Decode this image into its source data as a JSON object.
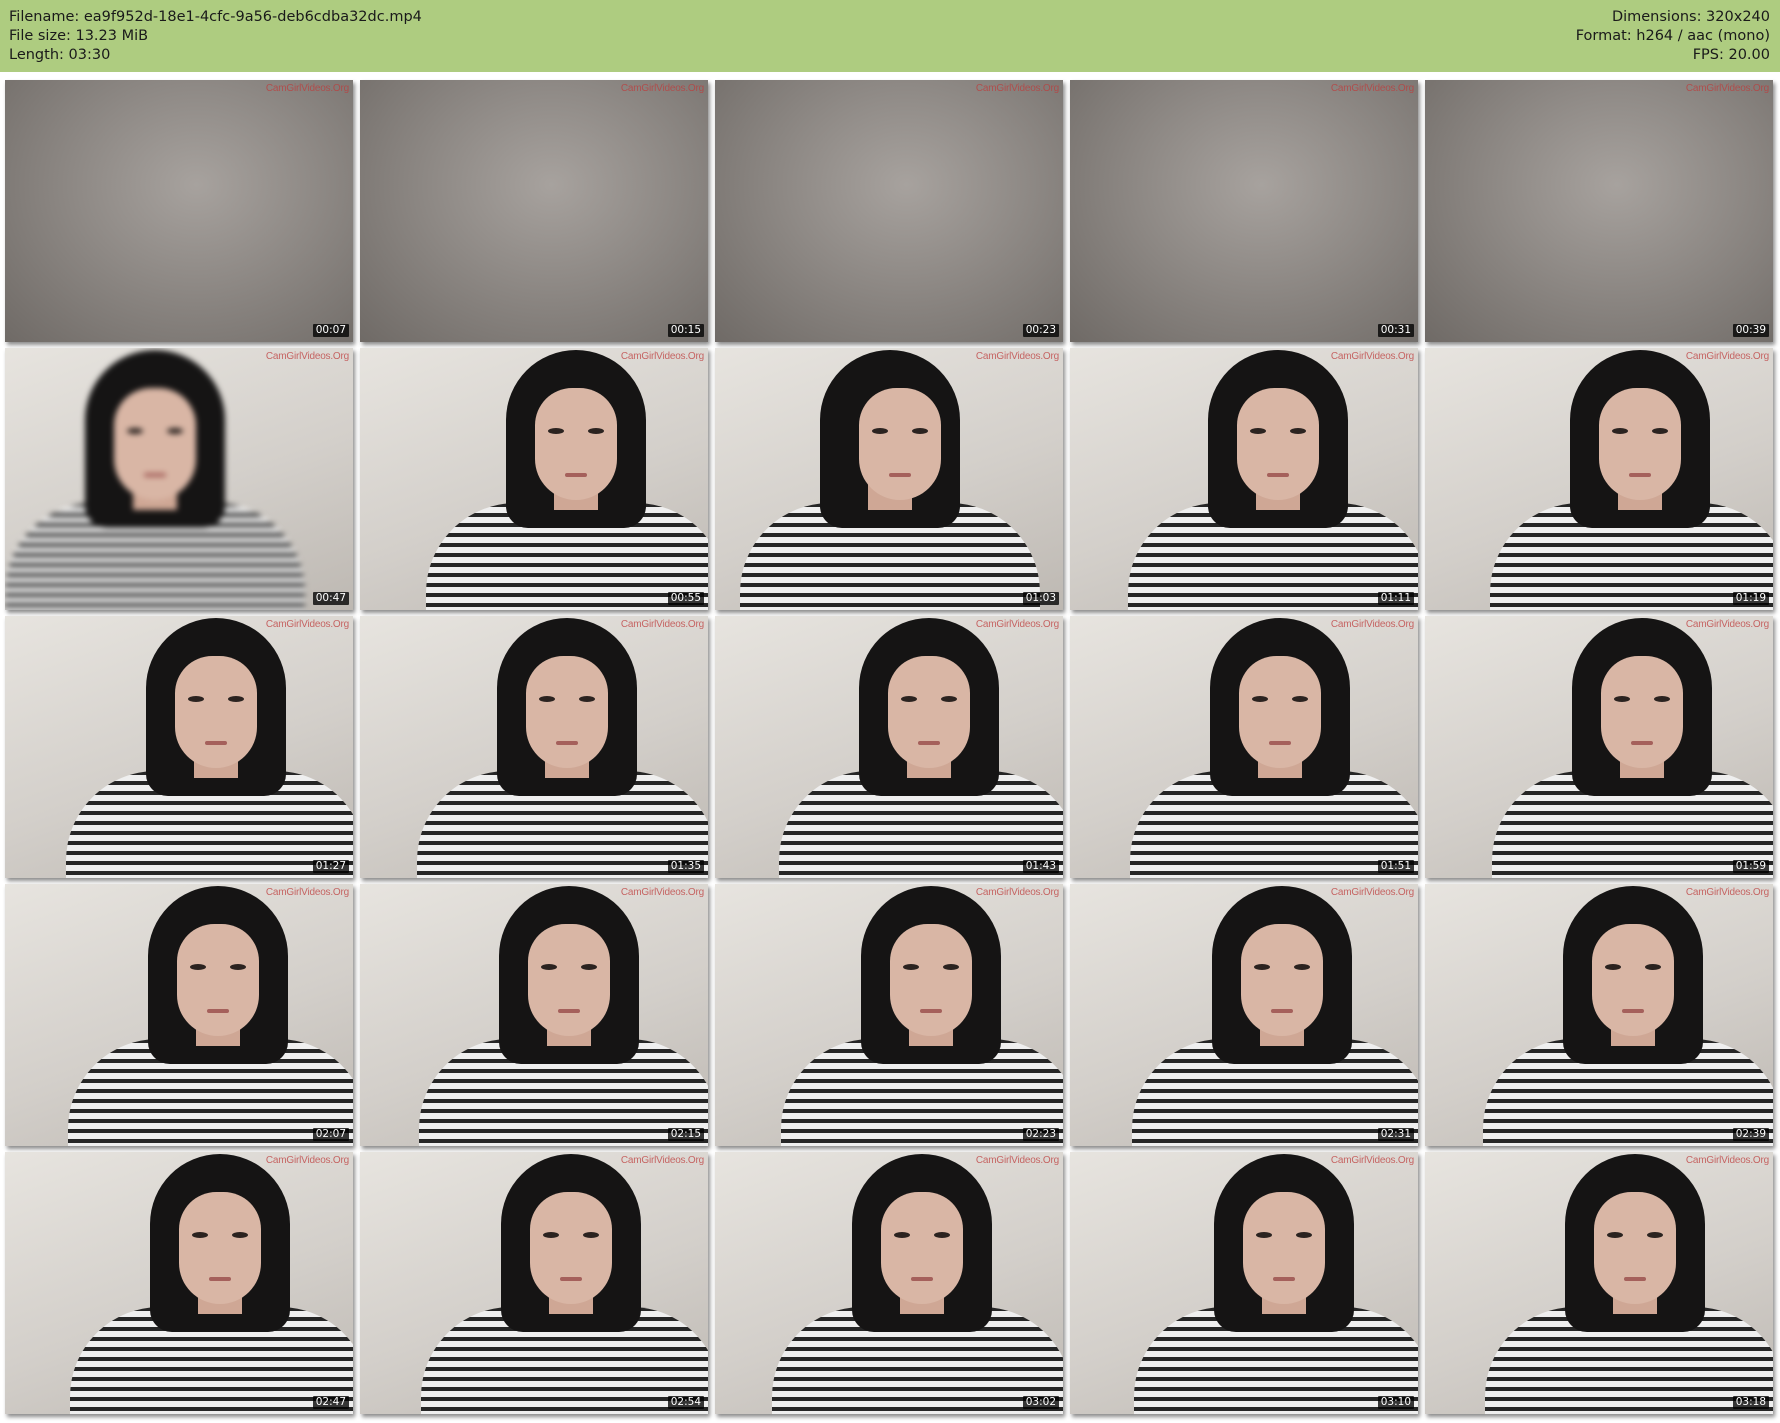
{
  "header": {
    "filename_line": "Filename: ea9f952d-18e1-4cfc-9a56-deb6cdba32dc.mp4",
    "filesize_line": "File size: 13.23 MiB",
    "length_line": "Length: 03:30",
    "dimensions_line": "Dimensions: 320x240",
    "format_line": "Format: h264 / aac (mono)",
    "fps_line": "FPS: 20.00"
  },
  "watermark": "CamGirlVideos.Org",
  "thumbnails": [
    {
      "time": "00:07",
      "scene": "blank"
    },
    {
      "time": "00:15",
      "scene": "blank"
    },
    {
      "time": "00:23",
      "scene": "blank"
    },
    {
      "time": "00:31",
      "scene": "blank"
    },
    {
      "time": "00:39",
      "scene": "blank"
    },
    {
      "time": "00:47",
      "scene": "person-blurred"
    },
    {
      "time": "00:55",
      "scene": "person"
    },
    {
      "time": "01:03",
      "scene": "person-turned"
    },
    {
      "time": "01:11",
      "scene": "person"
    },
    {
      "time": "01:19",
      "scene": "person"
    },
    {
      "time": "01:27",
      "scene": "person"
    },
    {
      "time": "01:35",
      "scene": "person"
    },
    {
      "time": "01:43",
      "scene": "person"
    },
    {
      "time": "01:51",
      "scene": "person"
    },
    {
      "time": "01:59",
      "scene": "person"
    },
    {
      "time": "02:07",
      "scene": "person"
    },
    {
      "time": "02:15",
      "scene": "person"
    },
    {
      "time": "02:23",
      "scene": "person"
    },
    {
      "time": "02:31",
      "scene": "person"
    },
    {
      "time": "02:39",
      "scene": "person"
    },
    {
      "time": "02:47",
      "scene": "person"
    },
    {
      "time": "02:54",
      "scene": "person"
    },
    {
      "time": "03:02",
      "scene": "person"
    },
    {
      "time": "03:10",
      "scene": "person"
    },
    {
      "time": "03:18",
      "scene": "person"
    }
  ]
}
